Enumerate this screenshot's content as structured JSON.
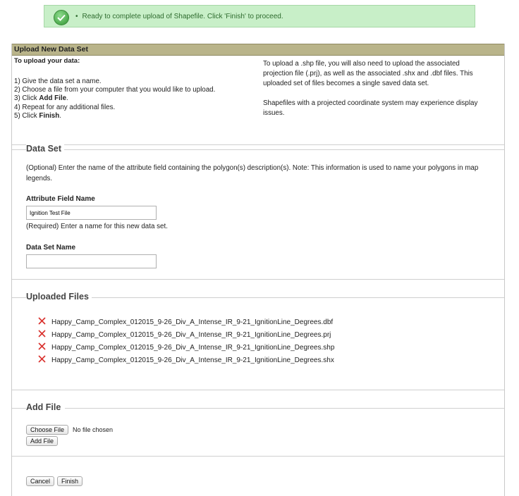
{
  "notice": {
    "message": "Ready to complete upload of Shapefile. Click 'Finish' to proceed.",
    "icon": "check-icon",
    "color": "#c8efc8"
  },
  "panel": {
    "title": "Upload New Data Set",
    "header_color": "#b9b48a",
    "intro_title": "To upload your data:",
    "steps": [
      {
        "prefix": "1) Give the data set a name.",
        "bold": "",
        "suffix": ""
      },
      {
        "prefix": "2) Choose a file from your computer that you would like to upload.",
        "bold": "",
        "suffix": ""
      },
      {
        "prefix": "3) Click ",
        "bold": "Add File",
        "suffix": "."
      },
      {
        "prefix": "4) Repeat for any additional files.",
        "bold": "",
        "suffix": ""
      },
      {
        "prefix": "5) Click ",
        "bold": "Finish",
        "suffix": "."
      }
    ],
    "right_p1": "To upload a .shp file, you will also need to upload the associated projection file (.prj), as well as the associated .shx and .dbf files. This uploaded set of files becomes a single saved data set.",
    "right_p2": "Shapefiles with a projected coordinate system may experience display issues."
  },
  "data_set": {
    "legend": "Data Set",
    "optional_note": "(Optional) Enter the name of the attribute field containing the polygon(s) description(s). Note: This information is used to name your polygons in map legends.",
    "attribute_label": "Attribute Field Name",
    "attribute_value": "Ignition Test File",
    "required_note": "(Required) Enter a name for this new data set.",
    "name_label": "Data Set Name",
    "name_value": ""
  },
  "uploaded_files": {
    "legend": "Uploaded Files",
    "remove_icon": "delete-x-icon",
    "remove_color": "#d9302c",
    "files": [
      "Happy_Camp_Complex_012015_9-26_Div_A_Intense_IR_9-21_IgnitionLine_Degrees.dbf",
      "Happy_Camp_Complex_012015_9-26_Div_A_Intense_IR_9-21_IgnitionLine_Degrees.prj",
      "Happy_Camp_Complex_012015_9-26_Div_A_Intense_IR_9-21_IgnitionLine_Degrees.shp",
      "Happy_Camp_Complex_012015_9-26_Div_A_Intense_IR_9-21_IgnitionLine_Degrees.shx"
    ]
  },
  "add_file": {
    "legend": "Add File",
    "choose_label": "Choose File",
    "no_file_text": "No file chosen",
    "add_label": "Add File"
  },
  "footer": {
    "cancel_label": "Cancel",
    "finish_label": "Finish"
  }
}
